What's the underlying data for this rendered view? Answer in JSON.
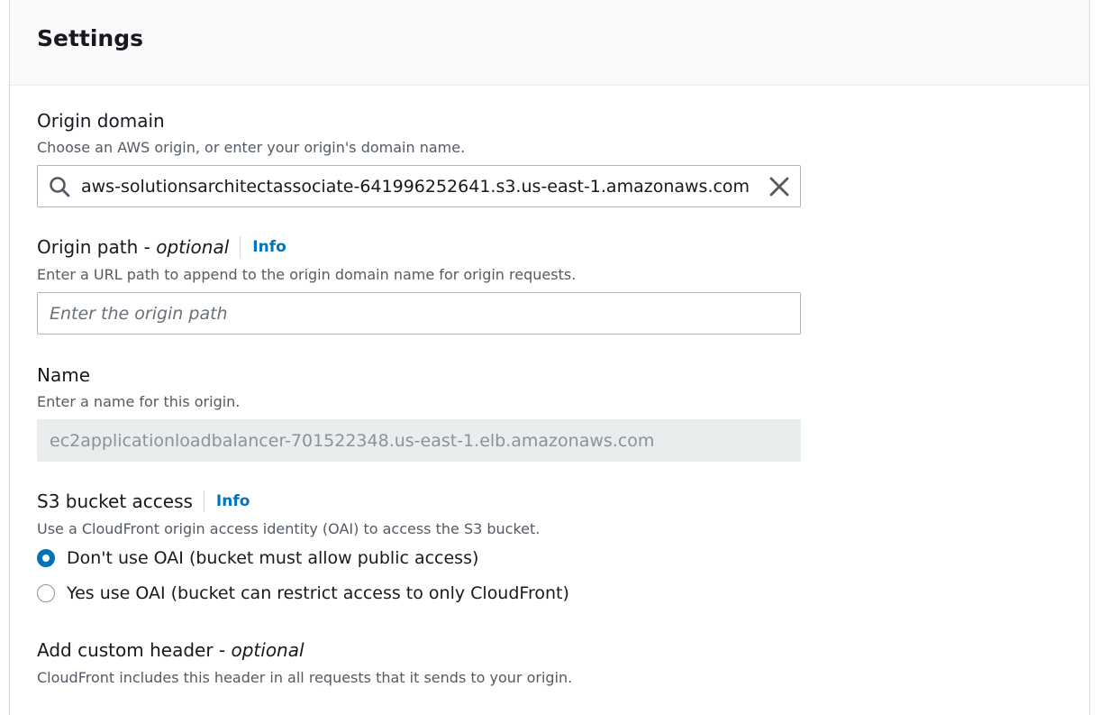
{
  "panel": {
    "title": "Settings"
  },
  "origin_domain": {
    "label": "Origin domain",
    "description": "Choose an AWS origin, or enter your origin's domain name.",
    "value": "aws-solutionsarchitectassociate-641996252641.s3.us-east-1.amazonaws.com"
  },
  "origin_path": {
    "label": "Origin path - ",
    "label_optional": "optional",
    "info": "Info",
    "description": "Enter a URL path to append to the origin domain name for origin requests.",
    "placeholder": "Enter the origin path"
  },
  "name": {
    "label": "Name",
    "description": "Enter a name for this origin.",
    "value": "ec2applicationloadbalancer-701522348.us-east-1.elb.amazonaws.com"
  },
  "s3_bucket_access": {
    "label": "S3 bucket access",
    "info": "Info",
    "description": "Use a CloudFront origin access identity (OAI) to access the S3 bucket.",
    "options": [
      {
        "label": "Don't use OAI (bucket must allow public access)",
        "selected": true
      },
      {
        "label": "Yes use OAI (bucket can restrict access to only CloudFront)",
        "selected": false
      }
    ]
  },
  "custom_header": {
    "label": "Add custom header - ",
    "label_optional": "optional",
    "description": "CloudFront includes this header in all requests that it sends to your origin."
  },
  "colors": {
    "accent": "#0073bb",
    "text": "#16191f",
    "secondary_text": "#545b64",
    "disabled_bg": "#eaeded"
  }
}
